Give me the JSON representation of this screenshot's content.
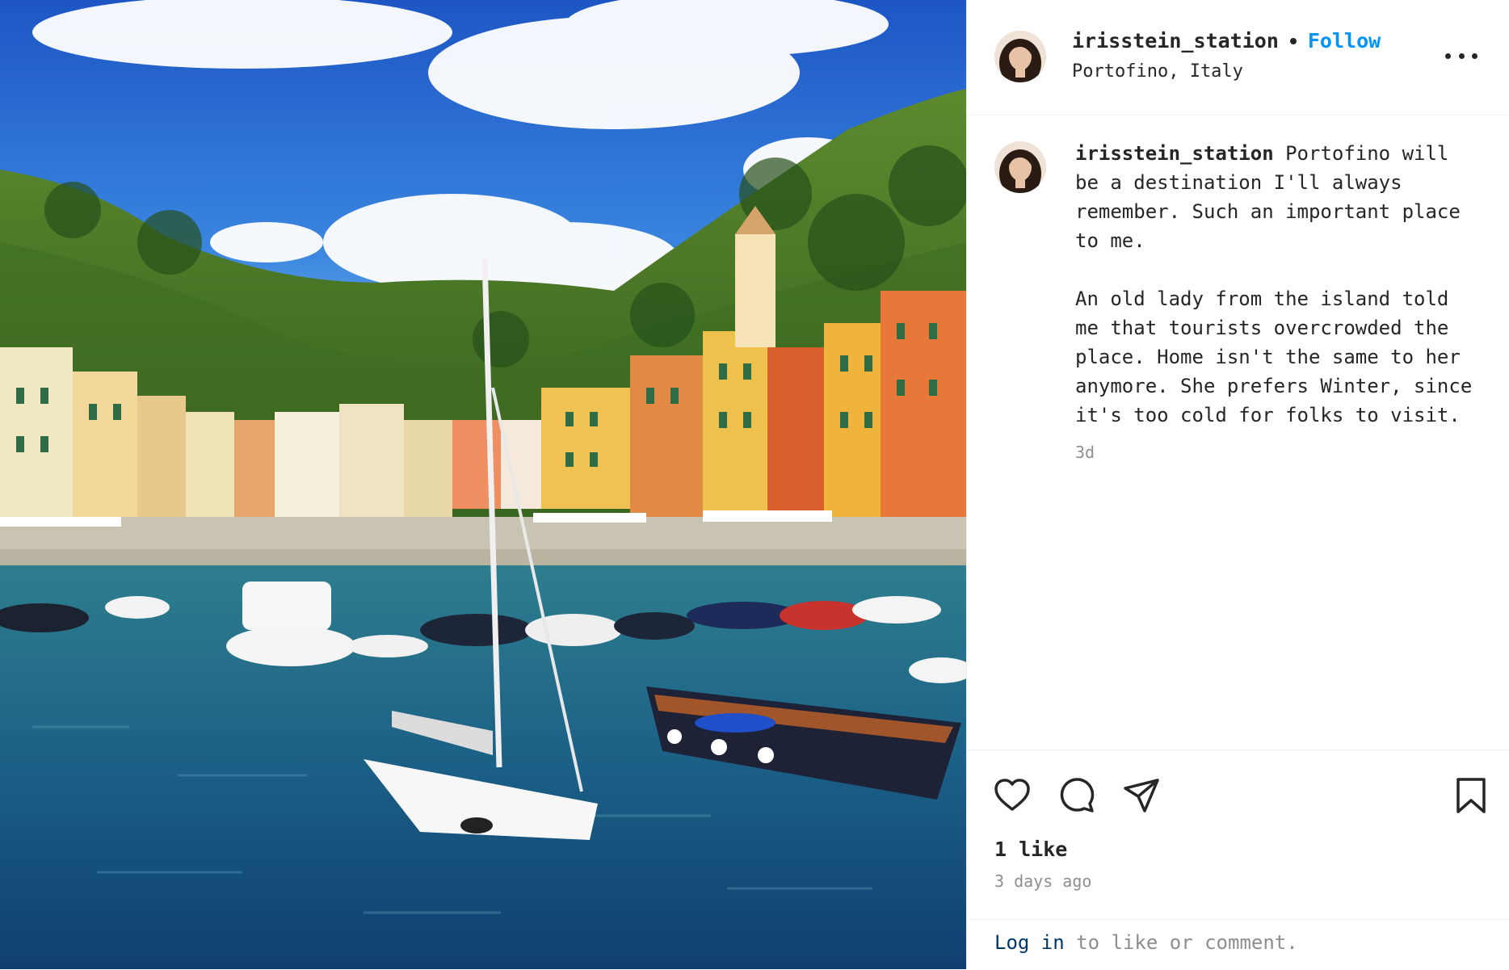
{
  "colors": {
    "link": "#0095f6",
    "text": "#262626",
    "muted": "#8e8e8e",
    "login_link": "#00376b"
  },
  "photo": {
    "subject": "Portofino harbor with colorful buildings, hills and boats"
  },
  "header": {
    "username": "irisstein_station",
    "follow_label": "Follow",
    "location": "Portofino, Italy",
    "more_icon": "more-horizontal-icon"
  },
  "caption": {
    "username": "irisstein_station",
    "text": " Portofino will be a destination I'll always remember. Such an important place to me.\n\nAn old lady from the island told me that tourists overcrowded the place. Home isn't the same to her anymore. She prefers Winter, since it's too cold for folks to visit.",
    "time": "3d"
  },
  "actions": {
    "icons": [
      "heart-icon",
      "comment-icon",
      "share-icon",
      "bookmark-icon"
    ],
    "likes": "1 like",
    "posted": "3 days ago"
  },
  "footer": {
    "login_label": "Log in",
    "rest": " to like or comment."
  }
}
